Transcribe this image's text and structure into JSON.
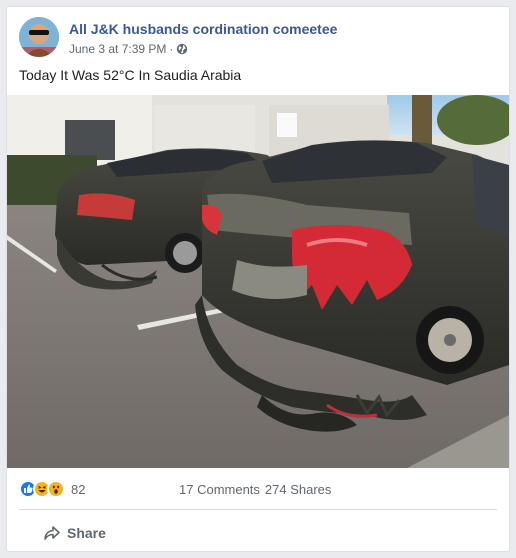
{
  "post": {
    "page_name": "All J&K husbands cordination comeetee",
    "timestamp": "June 3 at 7:39 PM",
    "separator": "·",
    "privacy_icon": "globe-icon",
    "text": "Today It Was 52°C In Saudia Arabia"
  },
  "engagement": {
    "reaction_icons": [
      "like-icon",
      "haha-icon",
      "wow-icon"
    ],
    "reaction_count": "82",
    "comments": "17 Comments",
    "shares": "274 Shares"
  },
  "actions": {
    "share_label": "Share",
    "share_icon": "share-arrow-icon"
  },
  "colors": {
    "link_blue": "#385898",
    "like_blue": "#1877f2",
    "reaction_yellow": "#f7b125",
    "secondary_text": "#606770"
  }
}
